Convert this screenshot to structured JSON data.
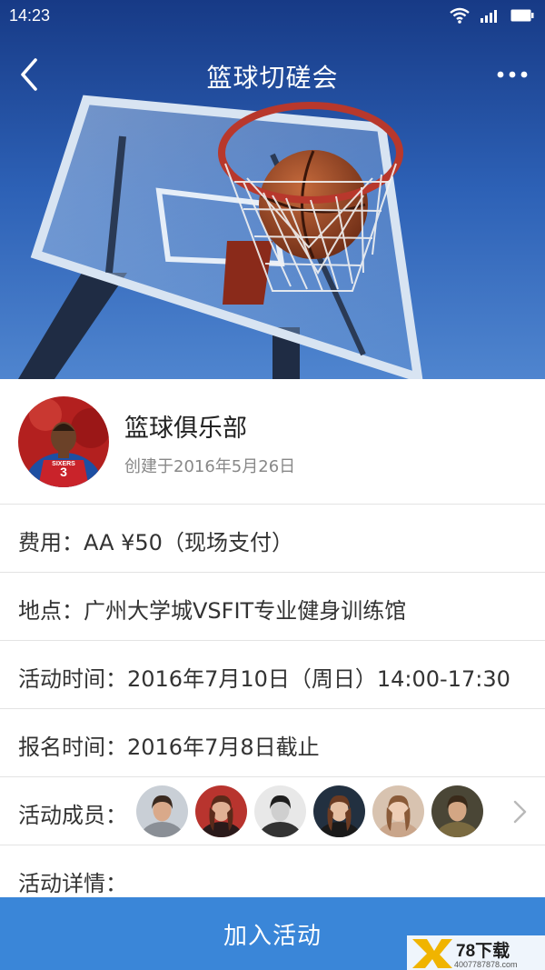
{
  "status_bar": {
    "time": "14:23"
  },
  "nav": {
    "title": "篮球切磋会"
  },
  "club": {
    "name": "篮球俱乐部",
    "created": "创建于2016年5月26日",
    "jersey_number": "3",
    "jersey_text": "SIXERS"
  },
  "fee": {
    "text": "费用：AA  ¥50（现场支付）"
  },
  "location": {
    "text": "地点：广州大学城VSFIT专业健身训练馆"
  },
  "event_time": {
    "text": "活动时间：2016年7月10日（周日）14:00-17:30"
  },
  "signup_time": {
    "text": "报名时间：2016年7月8日截止"
  },
  "members": {
    "label": "活动成员：",
    "avatars": [
      {
        "bg": "#c9cfd6",
        "hair": "#3a2a20",
        "shirt": "#8a8f96",
        "skin": "#d9a98a"
      },
      {
        "bg": "#b8342e",
        "hair": "#5a2a1a",
        "shirt": "#2a1a1a",
        "skin": "#e0b094"
      },
      {
        "bg": "#e8e8e8",
        "hair": "#1e1e1e",
        "shirt": "#333333",
        "skin": "#cfcfcf"
      },
      {
        "bg": "#223040",
        "hair": "#6b3b22",
        "shirt": "#1a1a1a",
        "skin": "#e6c0a4"
      },
      {
        "bg": "#d8c3b0",
        "hair": "#8a5a38",
        "shirt": "#c9a58a",
        "skin": "#efcdb5"
      },
      {
        "bg": "#4a4636",
        "hair": "#3a2a1a",
        "shirt": "#7a6a40",
        "skin": "#d3a684"
      }
    ]
  },
  "details": {
    "label": "活动详情："
  },
  "join": {
    "label": "加入活动"
  },
  "watermark": {
    "brand": "78下载",
    "domain": "4007787878.com"
  },
  "colors": {
    "primary": "#3a86d8",
    "sky": "#2a5bb0",
    "rim": "#c0392b"
  }
}
